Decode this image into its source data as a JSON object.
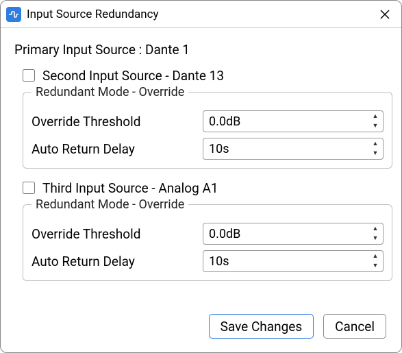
{
  "window": {
    "title": "Input Source Redundancy"
  },
  "primary": {
    "label_prefix": "Primary Input Source : ",
    "value": "Dante 1"
  },
  "second": {
    "checkbox_label": "Second Input Source - Dante 13",
    "checked": false,
    "group_title": "Redundant Mode - Override",
    "override_label": "Override Threshold",
    "override_value": "0.0dB",
    "delay_label": "Auto Return Delay",
    "delay_value": "10s"
  },
  "third": {
    "checkbox_label": "Third Input Source - Analog  A1",
    "checked": false,
    "group_title": "Redundant Mode - Override",
    "override_label": "Override Threshold",
    "override_value": "0.0dB",
    "delay_label": "Auto Return Delay",
    "delay_value": "10s"
  },
  "buttons": {
    "save": "Save Changes",
    "cancel": "Cancel"
  }
}
